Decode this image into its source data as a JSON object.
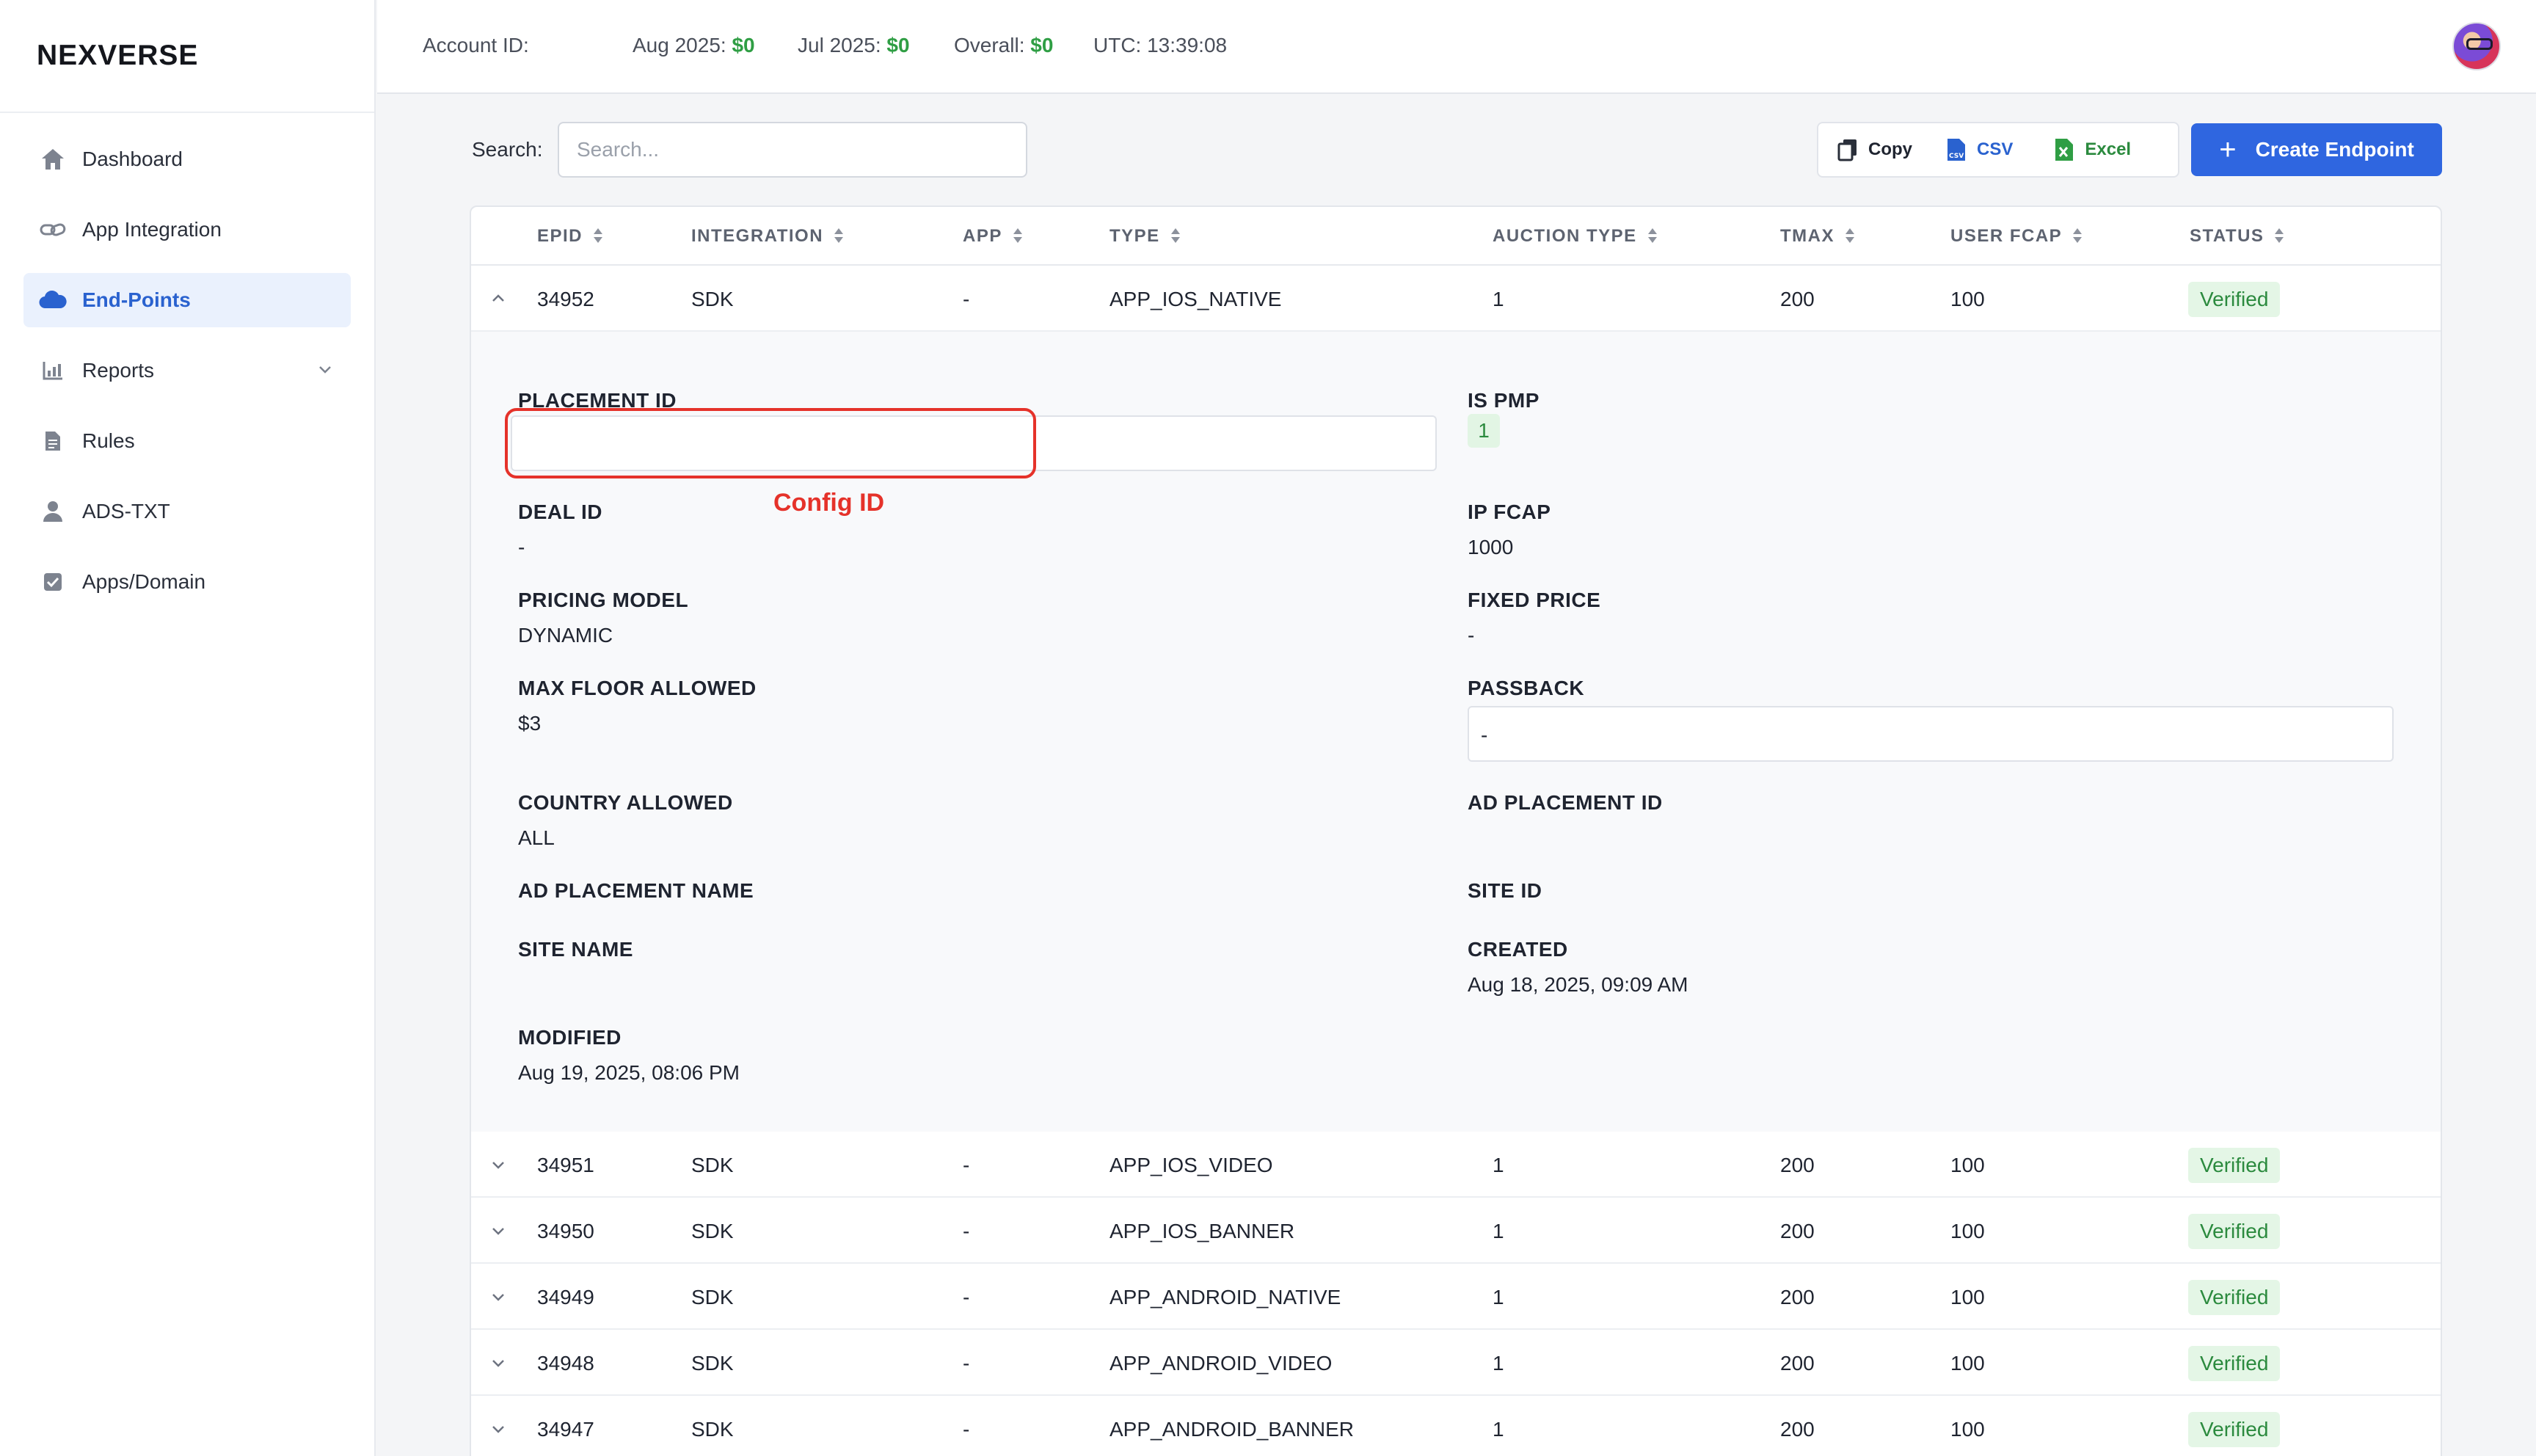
{
  "brand": "NEXVERSE",
  "sidebar": {
    "items": [
      {
        "label": "Dashboard",
        "icon": "home-icon"
      },
      {
        "label": "App Integration",
        "icon": "link-icon"
      },
      {
        "label": "End-Points",
        "icon": "cloud-icon",
        "active": true
      },
      {
        "label": "Reports",
        "icon": "chart-icon"
      },
      {
        "label": "Rules",
        "icon": "document-icon"
      },
      {
        "label": "ADS-TXT",
        "icon": "user-icon"
      },
      {
        "label": "Apps/Domain",
        "icon": "checkbox-icon"
      }
    ]
  },
  "topbar": {
    "account_label": "Account ID:",
    "aug_label": "Aug 2025:",
    "aug_value": "$0",
    "jul_label": "Jul 2025:",
    "jul_value": "$0",
    "overall_label": "Overall:",
    "overall_value": "$0",
    "utc": "UTC: 13:39:08"
  },
  "toolbar": {
    "search_label": "Search:",
    "search_placeholder": "Search...",
    "copy_label": "Copy",
    "csv_label": "CSV",
    "excel_label": "Excel",
    "create_label": "Create Endpoint"
  },
  "table": {
    "columns": [
      "EPID",
      "INTEGRATION",
      "APP",
      "TYPE",
      "AUCTION TYPE",
      "TMAX",
      "USER FCAP",
      "STATUS"
    ],
    "expanded_row": {
      "epid": "34952",
      "integration": "SDK",
      "app": "-",
      "type": "APP_IOS_NATIVE",
      "auction": "1",
      "tmax": "200",
      "fcap": "100",
      "status": "Verified"
    },
    "rows": [
      {
        "epid": "34951",
        "integration": "SDK",
        "app": "-",
        "type": "APP_IOS_VIDEO",
        "auction": "1",
        "tmax": "200",
        "fcap": "100",
        "status": "Verified"
      },
      {
        "epid": "34950",
        "integration": "SDK",
        "app": "-",
        "type": "APP_IOS_BANNER",
        "auction": "1",
        "tmax": "200",
        "fcap": "100",
        "status": "Verified"
      },
      {
        "epid": "34949",
        "integration": "SDK",
        "app": "-",
        "type": "APP_ANDROID_NATIVE",
        "auction": "1",
        "tmax": "200",
        "fcap": "100",
        "status": "Verified"
      },
      {
        "epid": "34948",
        "integration": "SDK",
        "app": "-",
        "type": "APP_ANDROID_VIDEO",
        "auction": "1",
        "tmax": "200",
        "fcap": "100",
        "status": "Verified"
      },
      {
        "epid": "34947",
        "integration": "SDK",
        "app": "-",
        "type": "APP_ANDROID_BANNER",
        "auction": "1",
        "tmax": "200",
        "fcap": "100",
        "status": "Verified"
      }
    ]
  },
  "detail": {
    "placement_id_label": "PLACEMENT ID",
    "placement_id_value": "",
    "is_pmp_label": "IS PMP",
    "is_pmp_value": "1",
    "deal_id_label": "DEAL ID",
    "deal_id_value": "-",
    "ip_fcap_label": "IP FCAP",
    "ip_fcap_value": "1000",
    "pricing_model_label": "PRICING MODEL",
    "pricing_model_value": "DYNAMIC",
    "fixed_price_label": "FIXED PRICE",
    "fixed_price_value": "-",
    "max_floor_label": "MAX FLOOR ALLOWED",
    "max_floor_value": "$3",
    "passback_label": "PASSBACK",
    "passback_value": "-",
    "country_label": "COUNTRY ALLOWED",
    "country_value": "ALL",
    "ad_placement_id_label": "AD PLACEMENT ID",
    "ad_placement_name_label": "AD PLACEMENT NAME",
    "site_id_label": "SITE ID",
    "site_name_label": "SITE NAME",
    "created_label": "CREATED",
    "created_value": "Aug 18, 2025, 09:09 AM",
    "modified_label": "MODIFIED",
    "modified_value": "Aug 19, 2025, 08:06 PM",
    "annotation": "Config ID"
  },
  "colors": {
    "accent": "#2f66e0",
    "money": "#2f9e44",
    "status_bg": "#e4f6e6",
    "status_text": "#2b8a3e",
    "annotation": "#e5322a",
    "pause": "#d8342c"
  }
}
